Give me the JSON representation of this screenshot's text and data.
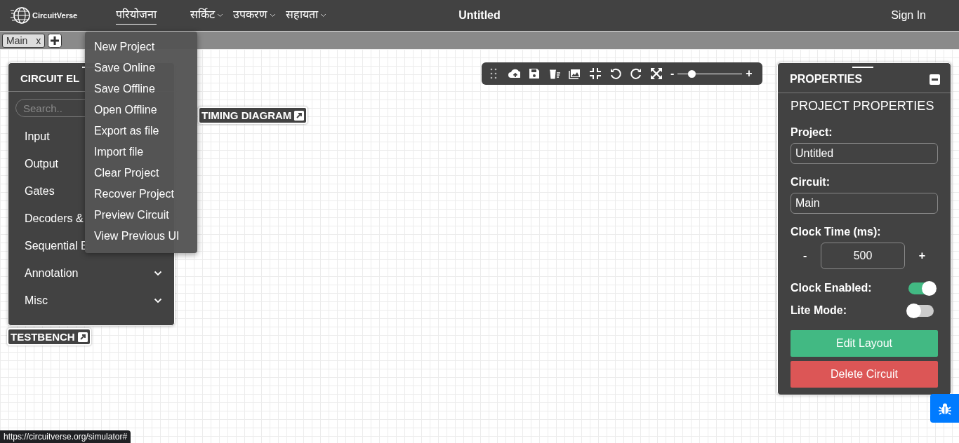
{
  "navbar": {
    "logo_text": "CircuitVerse",
    "menus": [
      {
        "label": "परियोजना",
        "selected": true,
        "dropdown": false
      },
      {
        "label": "सर्किट",
        "selected": false,
        "dropdown": true
      },
      {
        "label": "उपकरण",
        "selected": false,
        "dropdown": true
      },
      {
        "label": "सहायता",
        "selected": false,
        "dropdown": true
      }
    ],
    "title": "Untitled",
    "sign_in": "Sign In"
  },
  "circuit_tabs": [
    {
      "label": "Main",
      "close": "x",
      "selected": true
    }
  ],
  "project_menu": {
    "items": [
      "New Project",
      "Save Online",
      "Save Offline",
      "Open Offline",
      "Export as file",
      "Import file",
      "Clear Project",
      "Recover Project",
      "Preview Circuit",
      "View Previous UI"
    ]
  },
  "elements_panel": {
    "title": "CIRCUIT EL",
    "search": {
      "placeholder": "Search.."
    },
    "categories": [
      {
        "label": "Input"
      },
      {
        "label": "Output"
      },
      {
        "label": "Gates"
      },
      {
        "label": "Decoders &"
      },
      {
        "label": "Sequential E"
      },
      {
        "label": "Annotation",
        "expander": true
      },
      {
        "label": "Misc",
        "expander": true
      }
    ]
  },
  "testbench": {
    "label": "TESTBENCH"
  },
  "timing_diagram": {
    "label": "TIMING DIAGRAM"
  },
  "toolbar": {
    "zoom": {
      "minus": "-",
      "plus": "+",
      "level": 0.15
    }
  },
  "properties": {
    "title": "PROPERTIES",
    "heading": "PROJECT PROPERTIES",
    "fields": [
      {
        "label": "Project:",
        "value": "Untitled"
      },
      {
        "label": "Circuit:",
        "value": "Main"
      }
    ],
    "clock_time": {
      "label": "Clock Time (ms):",
      "minus": "-",
      "value": "500",
      "plus": "+"
    },
    "toggles": [
      {
        "label": "Clock Enabled:",
        "on": true
      },
      {
        "label": "Lite Mode:",
        "on": false
      }
    ],
    "buttons": [
      {
        "label": "Edit Layout",
        "kind": "primary"
      },
      {
        "label": "Delete Circuit",
        "kind": "danger"
      }
    ]
  },
  "status_url": "https://circuitverse.org/simulator#"
}
